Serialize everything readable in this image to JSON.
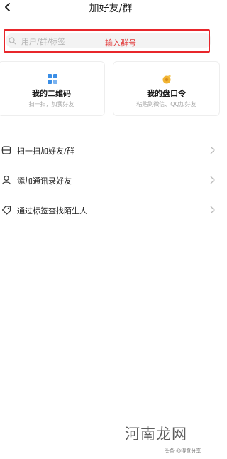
{
  "header": {
    "title": "加好友/群"
  },
  "search": {
    "placeholder": "用户/群/标签"
  },
  "annotation": {
    "text": "输入群号",
    "color": "#e8262b"
  },
  "cards": [
    {
      "title": "我的二维码",
      "subtitle": "扫一扫，加我好友",
      "icon": "qr-code-icon"
    },
    {
      "title": "我的盘口令",
      "subtitle": "粘贴到微信、QQ加好友",
      "icon": "coin-icon"
    }
  ],
  "rows": [
    {
      "label": "扫一扫加好友/群",
      "icon": "scan-icon"
    },
    {
      "label": "添加通讯录好友",
      "icon": "contact-icon"
    },
    {
      "label": "通过标签查找陌生人",
      "icon": "tag-icon"
    }
  ],
  "watermark": {
    "main": "河南龙网",
    "small": "头条 @得意分享"
  },
  "colors": {
    "accent": "#3a8ee6",
    "coin": "#f1b433"
  }
}
